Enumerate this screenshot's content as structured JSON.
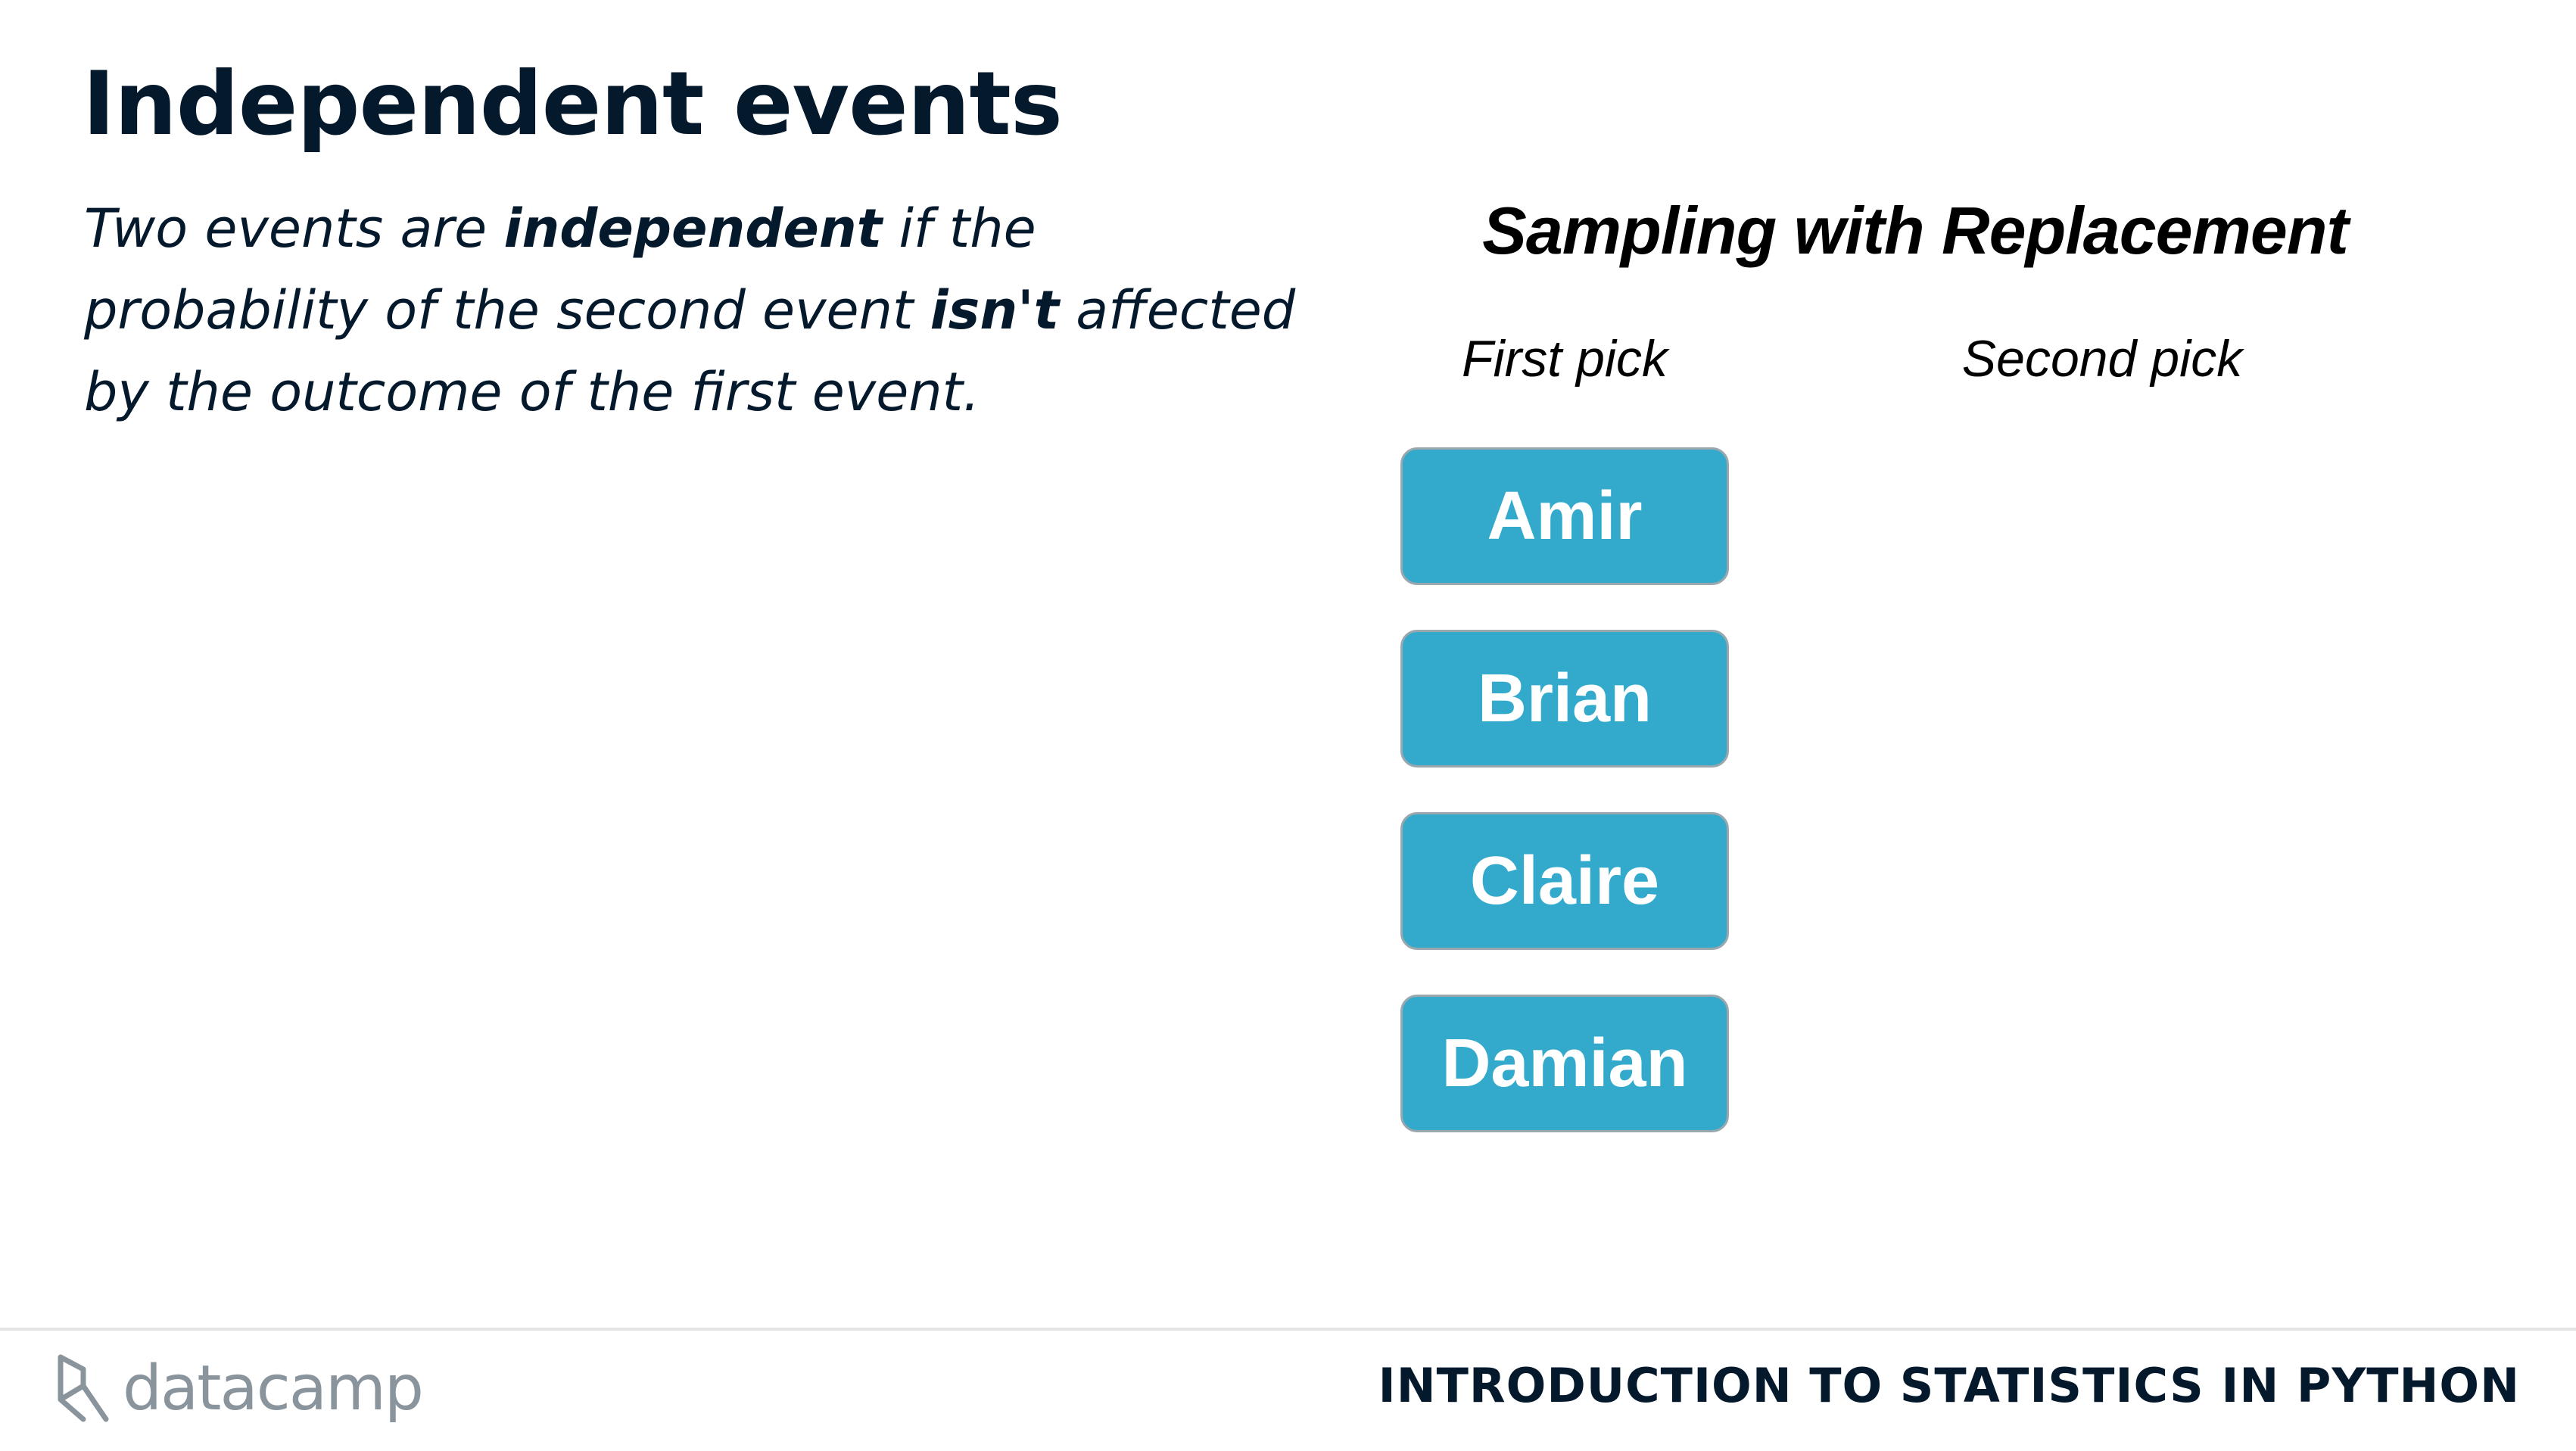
{
  "slide": {
    "title": "Independent events",
    "body": {
      "part1": "Two events are ",
      "emphasis1": "independent",
      "part2": " if the probability of the second event ",
      "emphasis2": "isn't",
      "part3": " affected by the outcome of the first event."
    }
  },
  "diagram": {
    "title": "Sampling with Replacement",
    "first_pick_label": "First pick",
    "second_pick_label": "Second pick",
    "names": [
      "Amir",
      "Brian",
      "Claire",
      "Damian"
    ],
    "box_color": "#33aacc"
  },
  "footer": {
    "logo_text": "datacamp",
    "logo_icon": "datacamp-logo-icon",
    "course_name": "INTRODUCTION TO STATISTICS IN PYTHON"
  }
}
